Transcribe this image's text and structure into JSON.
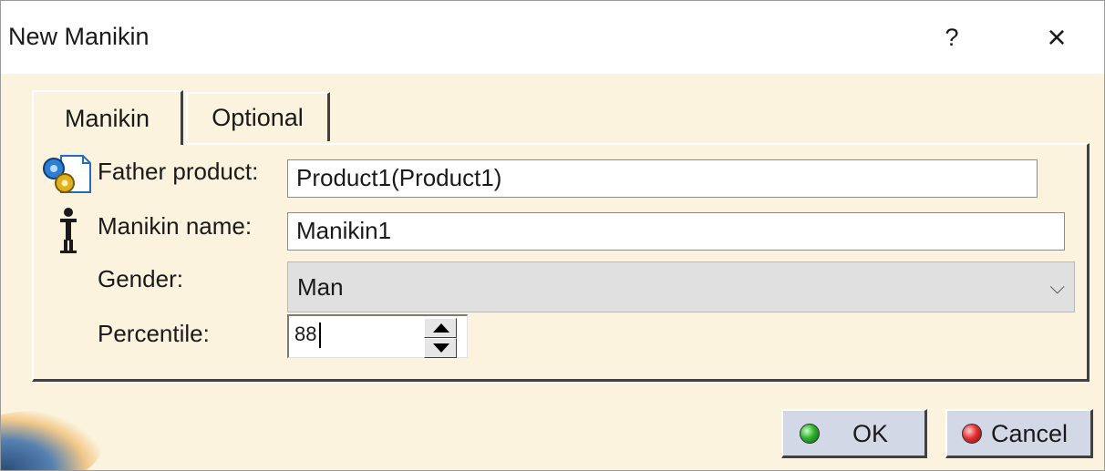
{
  "window": {
    "title": "New Manikin",
    "help_label": "?",
    "close_label": "×"
  },
  "tabs": [
    {
      "label": "Manikin",
      "active": true
    },
    {
      "label": "Optional",
      "active": false
    }
  ],
  "form": {
    "father_product": {
      "label": "Father product:",
      "value": "Product1(Product1)",
      "icon": "product-gears-icon"
    },
    "manikin_name": {
      "label": "Manikin name:",
      "value": "Manikin1",
      "icon": "manikin-figure-icon"
    },
    "gender": {
      "label": "Gender:",
      "value": "Man",
      "arrow": "⌵"
    },
    "percentile": {
      "label": "Percentile:",
      "value": "88"
    }
  },
  "buttons": {
    "ok": {
      "label": "OK",
      "icon": "green-status-dot-icon",
      "color": "#2fb12f"
    },
    "cancel": {
      "label": "Cancel",
      "icon": "red-status-dot-icon",
      "color": "#e53030"
    }
  },
  "colors": {
    "background": "#fbf3dd",
    "button_face": "#d3d8e6",
    "combo_face": "#e0e0e0"
  }
}
